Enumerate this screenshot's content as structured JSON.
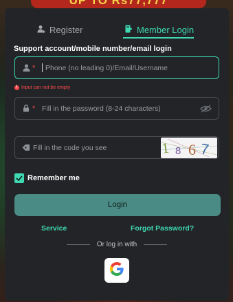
{
  "background": {
    "banner_text": "UP TO Rs77,777"
  },
  "tabs": {
    "register_label": "Register",
    "login_label": "Member Login",
    "active": "login"
  },
  "form": {
    "section_title": "Support account/mobile number/email login",
    "account": {
      "placeholder": "Phone (no leading 0)/Email/Username",
      "value": "",
      "error": "Input can not be empty"
    },
    "password": {
      "placeholder": "Fill in the password (8-24 characters)",
      "value": ""
    },
    "captcha": {
      "placeholder": "Fill in the code you see",
      "value": "",
      "image_text": "1867"
    },
    "remember_label": "Remember me",
    "remember_checked": true,
    "login_button": "Login"
  },
  "links": {
    "service": "Service",
    "forgot": "Forgot Password?"
  },
  "social": {
    "divider_text": "Or log in with",
    "providers": [
      "google"
    ]
  },
  "colors": {
    "accent": "#3fd8b2",
    "panel": "#222427",
    "button": "#4a8c85",
    "error": "#ff4a4a"
  }
}
